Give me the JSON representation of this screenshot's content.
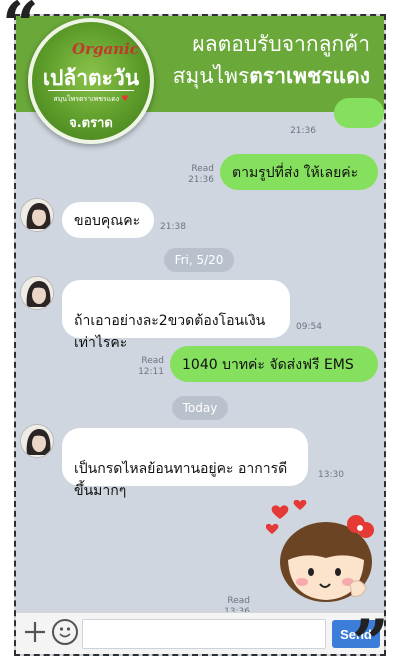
{
  "banner": {
    "line1": "ผลตอบรับจากลูกค้า",
    "line2_regular": "สมุนไพร",
    "line2_bold": "ตราเพชรแดง",
    "color": "#6aa83a"
  },
  "logo": {
    "organic": "Organic",
    "name": "เปล้าตะวัน",
    "subtitle": "สมุนไพรตราเพชรแดง",
    "province": "จ.ตราด"
  },
  "messages": [
    {
      "side": "me",
      "text": "ตามรูปที่ส่ง ให้เลยค่ะ",
      "read": "Read",
      "time": "21:36"
    },
    {
      "side": "them",
      "text": "ขอบคุณคะ",
      "time": "21:38"
    },
    {
      "side": "date",
      "text": "Fri, 5/20"
    },
    {
      "side": "them",
      "text": "ถ้าเอาอย่างละ2ขวดต้องโอนเงิน\nเท่าไรคะ",
      "time": "09:54"
    },
    {
      "side": "me",
      "text": "1040 บาทค่ะ จัดส่งฟรี EMS",
      "read": "Read",
      "time": "12:11"
    },
    {
      "side": "date",
      "text": "Today"
    },
    {
      "side": "them",
      "text": "เป็นกรดไหลย้อนทานอยู่คะ อาการดี\nขึ้นมากๆ",
      "time": "13:30"
    },
    {
      "side": "sticker",
      "read": "Read",
      "time": "13:36"
    }
  ],
  "topcut": {
    "time": "21:36"
  },
  "input": {
    "placeholder": "",
    "value": "",
    "send_label": "Send"
  },
  "colors": {
    "me_bubble": "#84e05d",
    "them_bubble": "#ffffff",
    "chat_bg": "#cfd6e0",
    "send": "#3b7dd8"
  }
}
